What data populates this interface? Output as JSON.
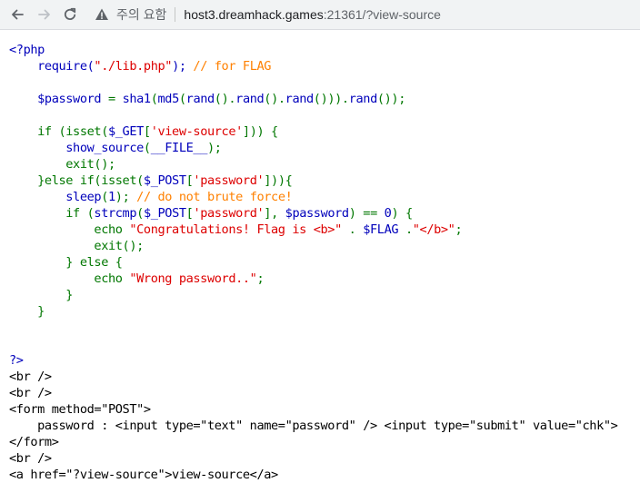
{
  "browser": {
    "warning_text": "주의 요함",
    "url_host": "host3.dreamhack.games",
    "url_rest": ":21361/?view-source"
  },
  "source_lines": [
    [
      {
        "c": "def",
        "t": "<?php"
      }
    ],
    [
      {
        "c": "def",
        "t": "    require("
      },
      {
        "c": "str",
        "t": "\"./lib.php\""
      },
      {
        "c": "def",
        "t": "); "
      },
      {
        "c": "cm",
        "t": "// for FLAG"
      }
    ],
    [],
    [
      {
        "c": "def",
        "t": "    $password "
      },
      {
        "c": "kw",
        "t": "= "
      },
      {
        "c": "def",
        "t": "sha1"
      },
      {
        "c": "kw",
        "t": "("
      },
      {
        "c": "def",
        "t": "md5"
      },
      {
        "c": "kw",
        "t": "("
      },
      {
        "c": "def",
        "t": "rand"
      },
      {
        "c": "kw",
        "t": "()."
      },
      {
        "c": "def",
        "t": "rand"
      },
      {
        "c": "kw",
        "t": "()."
      },
      {
        "c": "def",
        "t": "rand"
      },
      {
        "c": "kw",
        "t": "()))."
      },
      {
        "c": "def",
        "t": "rand"
      },
      {
        "c": "kw",
        "t": "());"
      }
    ],
    [],
    [
      {
        "c": "kw",
        "t": "    if (isset("
      },
      {
        "c": "def",
        "t": "$_GET"
      },
      {
        "c": "kw",
        "t": "["
      },
      {
        "c": "str",
        "t": "'view-source'"
      },
      {
        "c": "kw",
        "t": "])) {"
      }
    ],
    [
      {
        "c": "def",
        "t": "        show_source"
      },
      {
        "c": "kw",
        "t": "("
      },
      {
        "c": "def",
        "t": "__FILE__"
      },
      {
        "c": "kw",
        "t": ");"
      }
    ],
    [
      {
        "c": "kw",
        "t": "        exit();"
      }
    ],
    [
      {
        "c": "kw",
        "t": "    }else if(isset("
      },
      {
        "c": "def",
        "t": "$_POST"
      },
      {
        "c": "kw",
        "t": "["
      },
      {
        "c": "str",
        "t": "'password'"
      },
      {
        "c": "kw",
        "t": "])){"
      }
    ],
    [
      {
        "c": "def",
        "t": "        sleep"
      },
      {
        "c": "kw",
        "t": "("
      },
      {
        "c": "def",
        "t": "1"
      },
      {
        "c": "kw",
        "t": "); "
      },
      {
        "c": "cm",
        "t": "// do not brute force!"
      }
    ],
    [
      {
        "c": "kw",
        "t": "        if ("
      },
      {
        "c": "def",
        "t": "strcmp"
      },
      {
        "c": "kw",
        "t": "("
      },
      {
        "c": "def",
        "t": "$_POST"
      },
      {
        "c": "kw",
        "t": "["
      },
      {
        "c": "str",
        "t": "'password'"
      },
      {
        "c": "kw",
        "t": "], "
      },
      {
        "c": "def",
        "t": "$password"
      },
      {
        "c": "kw",
        "t": ") == "
      },
      {
        "c": "def",
        "t": "0"
      },
      {
        "c": "kw",
        "t": ") {"
      }
    ],
    [
      {
        "c": "kw",
        "t": "            echo "
      },
      {
        "c": "str",
        "t": "\"Congratulations! Flag is <b>\" "
      },
      {
        "c": "kw",
        "t": ". "
      },
      {
        "c": "def",
        "t": "$FLAG "
      },
      {
        "c": "kw",
        "t": "."
      },
      {
        "c": "str",
        "t": "\"</b>\""
      },
      {
        "c": "kw",
        "t": ";"
      }
    ],
    [
      {
        "c": "kw",
        "t": "            exit();"
      }
    ],
    [
      {
        "c": "kw",
        "t": "        } else {"
      }
    ],
    [
      {
        "c": "kw",
        "t": "            echo "
      },
      {
        "c": "str",
        "t": "\"Wrong password..\""
      },
      {
        "c": "kw",
        "t": ";"
      }
    ],
    [
      {
        "c": "kw",
        "t": "        }"
      }
    ],
    [
      {
        "c": "kw",
        "t": "    }"
      }
    ],
    [],
    [],
    [
      {
        "c": "def",
        "t": "?>"
      }
    ],
    [
      {
        "c": "html",
        "t": "<br />"
      }
    ],
    [
      {
        "c": "html",
        "t": "<br />"
      }
    ],
    [
      {
        "c": "html",
        "t": "<form method=\"POST\">"
      }
    ],
    [
      {
        "c": "html",
        "t": "    password : <input type=\"text\" name=\"password\" /> <input type=\"submit\" value=\"chk\">"
      }
    ],
    [
      {
        "c": "html",
        "t": "</form>"
      }
    ],
    [
      {
        "c": "html",
        "t": "<br />"
      }
    ],
    [
      {
        "c": "html",
        "t": "<a href=\"?view-source\">view-source</a>"
      }
    ]
  ]
}
